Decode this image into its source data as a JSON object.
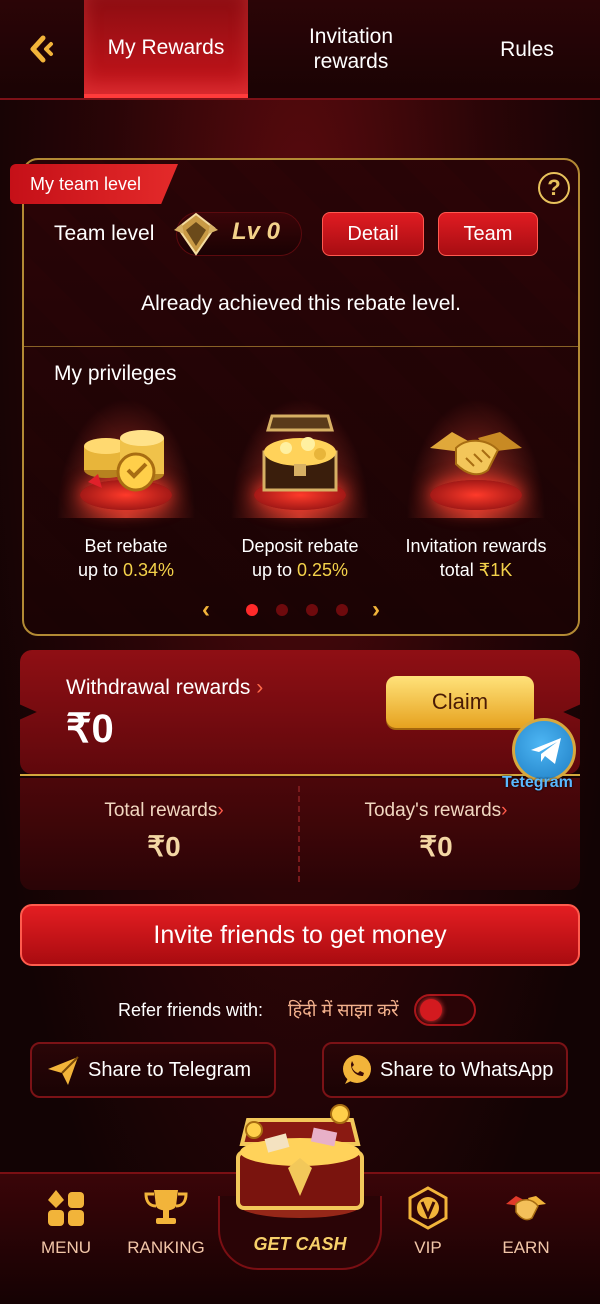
{
  "header": {
    "tabs": [
      {
        "label": "My Rewards",
        "active": true
      },
      {
        "label": "Invitation rewards",
        "active": false
      },
      {
        "label": "Rules",
        "active": false
      }
    ]
  },
  "team": {
    "ribbon": "My team level",
    "label": "Team level",
    "level": "Lv 0",
    "detail_btn": "Detail",
    "team_btn": "Team",
    "achieved": "Already achieved this rebate level."
  },
  "privileges": {
    "title": "My privileges",
    "items": [
      {
        "line1": "Bet rebate",
        "prefix": "up to ",
        "value": "0.34%",
        "icon": "gold-coins-icon"
      },
      {
        "line1": "Deposit rebate",
        "prefix": "up to ",
        "value": "0.25%",
        "icon": "treasure-chest-icon"
      },
      {
        "line1": "Invitation rewards",
        "prefix": "total ",
        "value": "₹1K",
        "icon": "handshake-icon"
      }
    ],
    "pager": {
      "pages": 4,
      "current": 1
    }
  },
  "withdrawal": {
    "label": "Withdrawal rewards",
    "amount": "₹0",
    "claim": "Claim"
  },
  "telegram_fab": {
    "label": "Tetegram"
  },
  "stats": {
    "total_label": "Total rewards",
    "total_value": "₹0",
    "today_label": "Today's rewards",
    "today_value": "₹0"
  },
  "invite_btn": "Invite friends to get money",
  "refer": {
    "label": "Refer friends with:",
    "hindi": "हिंदी में साझा करें",
    "toggle_on": false
  },
  "share": {
    "telegram": "Share to Telegram",
    "whatsapp": "Share to WhatsApp"
  },
  "nav": {
    "menu": "MENU",
    "ranking": "RANKING",
    "getcash": "GET CASH",
    "vip": "VIP",
    "earn": "EARN"
  },
  "colors": {
    "accent_red": "#e01c22",
    "gold": "#f4d24a",
    "background": "#120304"
  }
}
